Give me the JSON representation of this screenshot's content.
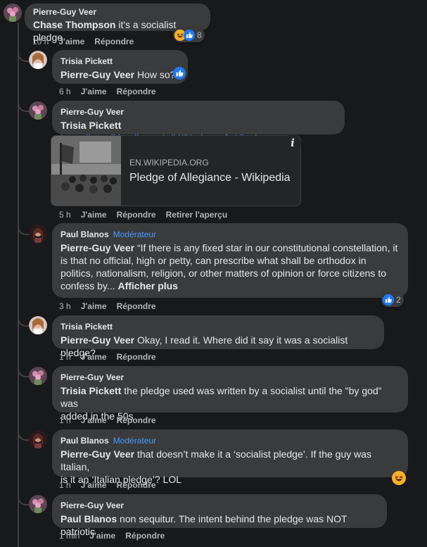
{
  "comments": [
    {
      "author": "Pierre-Guy Veer",
      "mention": "Chase Thompson",
      "text": " it's a socialist pledge",
      "time": "10 h",
      "like_label": "J'aime",
      "reply_label": "Répondre",
      "reaction_count": "8"
    },
    {
      "author": "Trisia Pickett",
      "mention": "Pierre-Guy Veer",
      "text": " How so?",
      "time": "6 h",
      "like_label": "J'aime",
      "reply_label": "Répondre"
    },
    {
      "author": "Pierre-Guy Veer",
      "mention": "Trisia Pickett",
      "link": "https://en.wikipedia.org/wiki/Pledge_of_Allegiance",
      "preview_domain": "EN.WIKIPEDIA.ORG",
      "preview_title": "Pledge of Allegiance - Wikipedia",
      "info_icon_label": "i",
      "time": "5 h",
      "like_label": "J'aime",
      "reply_label": "Répondre",
      "remove_preview_label": "Retirer l'aperçu"
    },
    {
      "author": "Paul Blanos",
      "badge": "Modérateur",
      "mention": "Pierre-Guy Veer",
      "line1": " “If there is any fixed star in our constitutional constellation, it",
      "line2": "is that no official, high or petty, can prescribe what shall be orthodox in",
      "line3": "politics, nationalism, religion, or other matters of opinion or force citizens to",
      "line4": "confess by...",
      "see_more": "Afficher plus",
      "time": "3 h",
      "like_label": "J'aime",
      "reply_label": "Répondre",
      "reaction_count": "2"
    },
    {
      "author": "Trisia Pickett",
      "mention": "Pierre-Guy Veer",
      "text": " Okay, I read it. Where did it say it was a socialist pledge?",
      "time": "1 h",
      "like_label": "J'aime",
      "reply_label": "Répondre"
    },
    {
      "author": "Pierre-Guy Veer",
      "mention": "Trisia Pickett",
      "line1": " the pledge used was written by a socialist until the \"by god\" was",
      "line2": "added in the 50s",
      "time": "1 h",
      "like_label": "J'aime",
      "reply_label": "Répondre"
    },
    {
      "author": "Paul Blanos",
      "badge": "Modérateur",
      "mention": "Pierre-Guy Veer",
      "line1": " that doesn’t make it a ‘socialist pledge’. If the guy was Italian,",
      "line2": "is it an ‘Italian pledge’? LOL",
      "time": "1 h",
      "like_label": "J'aime",
      "reply_label": "Répondre"
    },
    {
      "author": "Pierre-Guy Veer",
      "mention": "Paul Blanos",
      "text": " non sequitur. The intent behind the pledge was NOT patriotic",
      "time": "1 min",
      "like_label": "J'aime",
      "reply_label": "Répondre"
    }
  ],
  "colors": {
    "background": "#18191a",
    "bubble": "#3a3b3c",
    "link": "#4599ff",
    "like_blue": "#2078f4",
    "haha_yellow": "#f7b125",
    "muted_text": "#b0b3b8"
  }
}
